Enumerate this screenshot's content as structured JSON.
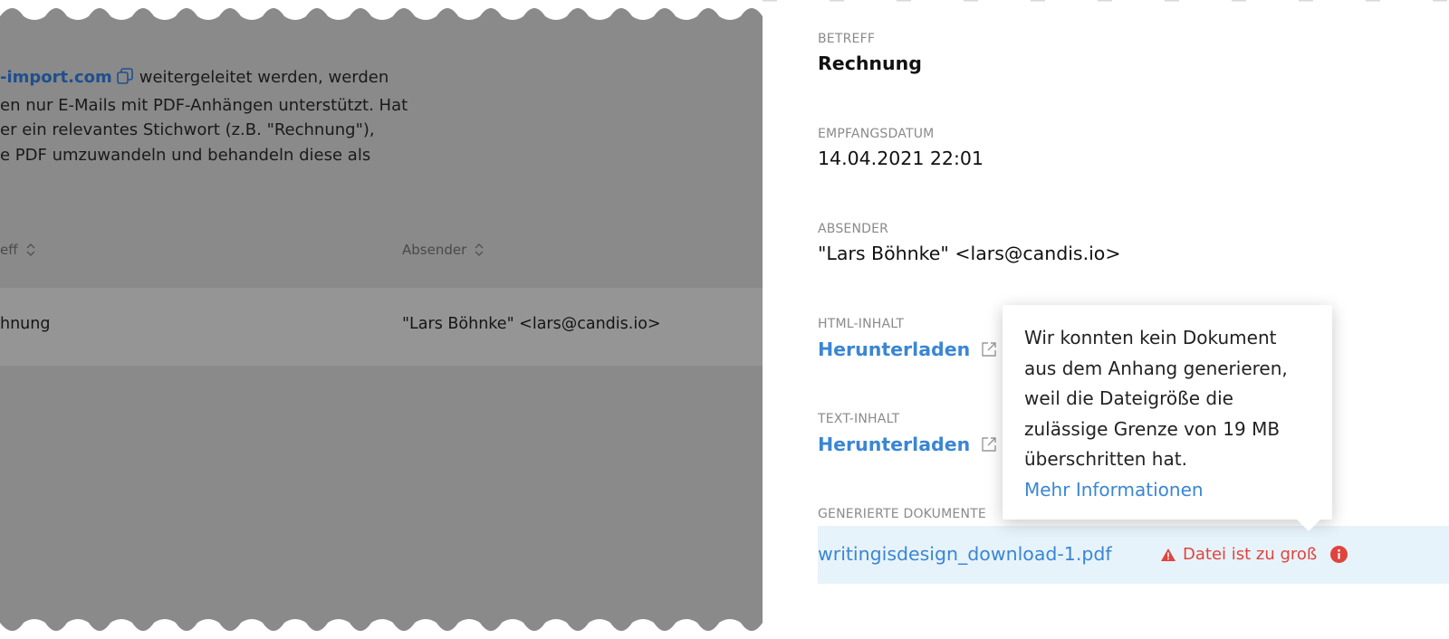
{
  "left_panel": {
    "intro_lines": [
      {
        "highlight": "-import.com",
        "text": "weitergeleitet werden, werden"
      },
      {
        "text": "en nur E-Mails mit PDF-Anhängen unterstützt. Hat"
      },
      {
        "text": "er ein relevantes Stichwort (z.B. \"Rechnung\"),"
      },
      {
        "text": "e PDF umzuwandeln und behandeln diese als"
      }
    ],
    "columns": {
      "subject": "eff",
      "sender": "Absender"
    },
    "row": {
      "subject": "hnung",
      "sender": "\"Lars Böhnke\" <lars@candis.io>"
    }
  },
  "details": {
    "subject_label": "BETREFF",
    "subject_value": "Rechnung",
    "received_label": "EMPFANGSDATUM",
    "received_value": "14.04.2021 22:01",
    "sender_label": "ABSENDER",
    "sender_value": "\"Lars Böhnke\" <lars@candis.io>",
    "html_label": "HTML-INHALT",
    "html_link": "Herunterladen",
    "text_label": "TEXT-INHALT",
    "text_link": "Herunterladen",
    "docs_label": "GENERIERTE DOKUMENTE",
    "doc_name": "writingisdesign_download-1.pdf",
    "doc_error": "Datei ist zu groß"
  },
  "tooltip": {
    "message": "Wir konnten kein Dokument aus dem Anhang generieren, weil die Dateigröße die zulässige Grenze von 19 MB überschritten hat.",
    "link": "Mehr Informationen"
  },
  "colors": {
    "overlay": "#8a8a8a",
    "link": "#3a86d4",
    "error": "#e0443d",
    "doc_row_bg": "#e7f3fb"
  }
}
